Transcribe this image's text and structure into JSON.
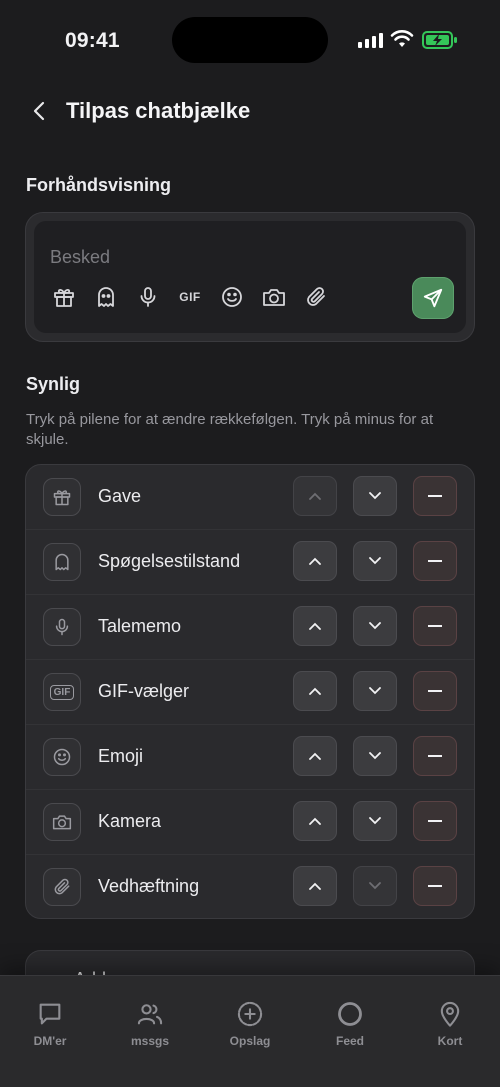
{
  "status": {
    "time": "09:41"
  },
  "header": {
    "title": "Tilpas chatbjælke"
  },
  "preview": {
    "section_title": "Forhåndsvisning",
    "placeholder": "Besked",
    "icons": [
      "gift-icon",
      "ghost-icon",
      "mic-icon",
      "GIF",
      "emoji-icon",
      "camera-icon",
      "paperclip-icon"
    ],
    "gif_label": "GIF"
  },
  "visible": {
    "section_title": "Synlig",
    "hint": "Tryk på pilene for at ændre rækkefølgen. Tryk på minus for at skjule.",
    "items": [
      {
        "label": "Gave",
        "icon": "gift-icon",
        "up_enabled": false,
        "down_enabled": true
      },
      {
        "label": "Spøgelsestilstand",
        "icon": "ghost-icon",
        "up_enabled": true,
        "down_enabled": true
      },
      {
        "label": "Talememo",
        "icon": "mic-icon",
        "up_enabled": true,
        "down_enabled": true
      },
      {
        "label": "GIF-vælger",
        "icon": "gif-icon",
        "up_enabled": true,
        "down_enabled": true
      },
      {
        "label": "Emoji",
        "icon": "emoji-icon",
        "up_enabled": true,
        "down_enabled": true
      },
      {
        "label": "Kamera",
        "icon": "camera-icon",
        "up_enabled": true,
        "down_enabled": true
      },
      {
        "label": "Vedhæftning",
        "icon": "paperclip-icon",
        "up_enabled": true,
        "down_enabled": false
      }
    ],
    "gif_icon_text": "GIF"
  },
  "add_card": {
    "label": "Add"
  },
  "tabbar": {
    "tabs": [
      {
        "label": "DM'er",
        "icon": "chat-bubble-icon"
      },
      {
        "label": "mssgs",
        "icon": "people-icon"
      },
      {
        "label": "Opslag",
        "icon": "plus-circle-icon"
      },
      {
        "label": "Feed",
        "icon": "circle-icon"
      },
      {
        "label": "Kort",
        "icon": "map-pin-icon"
      }
    ]
  },
  "colors": {
    "background": "#1c1c1e",
    "send_button": "#4a8a5a",
    "battery": "#34c759"
  }
}
